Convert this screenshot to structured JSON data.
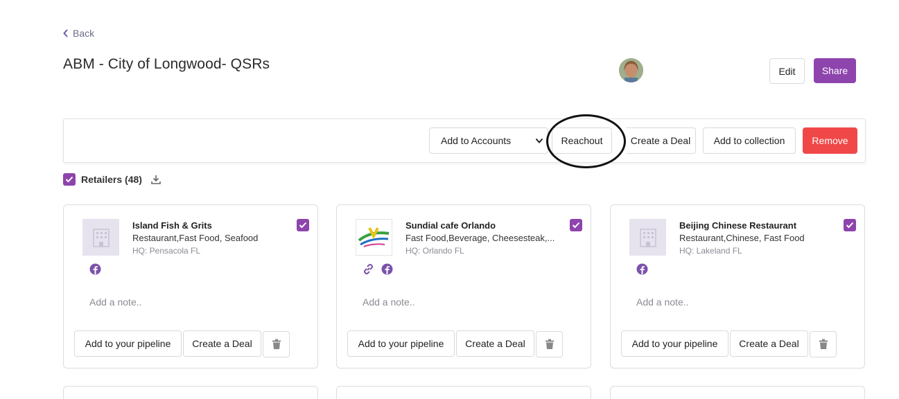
{
  "header": {
    "back_label": "Back",
    "title": "ABM - City of Longwood- QSRs",
    "edit_label": "Edit",
    "share_label": "Share"
  },
  "toolbar": {
    "accounts_select": "Add to Accounts",
    "reachout_label": "Reachout",
    "create_deal_label": "Create a Deal",
    "add_collection_label": "Add to collection",
    "remove_label": "Remove"
  },
  "retailers": {
    "label": "Retailers (48)"
  },
  "cards": [
    {
      "name": "Island Fish & Grits",
      "categories": "Restaurant,Fast Food, Seafood",
      "hq": "HQ: Pensacola FL",
      "note_placeholder": "Add a note..",
      "pipeline_label": "Add to your pipeline",
      "deal_label": "Create a Deal"
    },
    {
      "name": "Sundial cafe Orlando",
      "categories": "Fast Food,Beverage, Cheesesteak,...",
      "hq": "HQ: Orlando FL",
      "note_placeholder": "Add a note..",
      "pipeline_label": "Add to your pipeline",
      "deal_label": "Create a Deal"
    },
    {
      "name": "Beijing Chinese Restaurant",
      "categories": "Restaurant,Chinese, Fast Food",
      "hq": "HQ: Lakeland FL",
      "note_placeholder": "Add a note..",
      "pipeline_label": "Add to your pipeline",
      "deal_label": "Create a Deal"
    }
  ],
  "colors": {
    "accent": "#8e44ad",
    "danger": "#f04848",
    "social_icon": "#7b52ab"
  }
}
